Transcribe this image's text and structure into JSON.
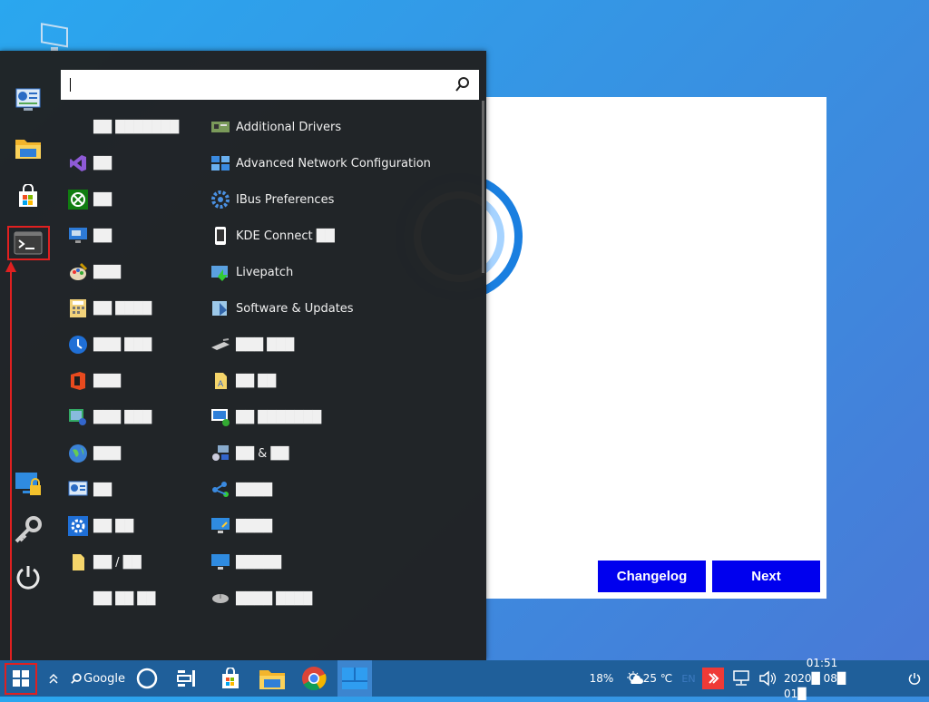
{
  "welcome": {
    "changelog_label": "Changelog",
    "next_label": "Next"
  },
  "search": {
    "value": ""
  },
  "apps_left": [
    {
      "icon": "blank-icon",
      "text": "██ ███████"
    },
    {
      "icon": "visual-studio-icon",
      "text": "██"
    },
    {
      "icon": "xbox-icon",
      "text": "██"
    },
    {
      "icon": "remote-desktop-icon",
      "text": "██"
    },
    {
      "icon": "paint-icon",
      "text": "███"
    },
    {
      "icon": "calculator-icon",
      "text": "██ ████"
    },
    {
      "icon": "backup-icon",
      "text": "███ ███"
    },
    {
      "icon": "office-icon",
      "text": "███"
    },
    {
      "icon": "media-player-icon",
      "text": "███ ███"
    },
    {
      "icon": "browser-globe-icon",
      "text": "███"
    },
    {
      "icon": "system-monitor-icon",
      "text": "██"
    },
    {
      "icon": "settings-gear-icon",
      "text": "██ ██"
    },
    {
      "icon": "file-folder-icon",
      "text": "██ / ██"
    },
    {
      "icon": "blank-icon",
      "text": "██ ██ ██"
    }
  ],
  "apps_right": [
    {
      "icon": "additional-drivers-icon",
      "text": "Additional Drivers"
    },
    {
      "icon": "network-config-icon",
      "text": "Advanced Network Configuration"
    },
    {
      "icon": "ibus-gear-icon",
      "text": "IBus Preferences"
    },
    {
      "icon": "kde-connect-icon",
      "text": "KDE Connect ██"
    },
    {
      "icon": "livepatch-icon",
      "text": "Livepatch"
    },
    {
      "icon": "software-updates-icon",
      "text": "Software & Updates"
    },
    {
      "icon": "tablet-icon",
      "text": "███ ███"
    },
    {
      "icon": "folder-text-icon",
      "text": "██ ██"
    },
    {
      "icon": "display-check-icon",
      "text": "██ ███████"
    },
    {
      "icon": "network-share-icon",
      "text": "██ & ██"
    },
    {
      "icon": "bluetooth-share-icon",
      "text": "████"
    },
    {
      "icon": "display-settings-icon",
      "text": "████"
    },
    {
      "icon": "monitor-icon",
      "text": "█████"
    },
    {
      "icon": "mouse-icon",
      "text": "████ ████"
    }
  ],
  "taskbar": {
    "search_label": "Google",
    "battery": "18%",
    "weather": "25 ℃",
    "language": "EN",
    "time": "01:51",
    "date": "2020█ 08█ 01█"
  },
  "colors": {
    "accent": "#0000ee",
    "taskbar": "#1f5f9a",
    "menu_bg": "#202020",
    "annotation": "#e02020"
  }
}
